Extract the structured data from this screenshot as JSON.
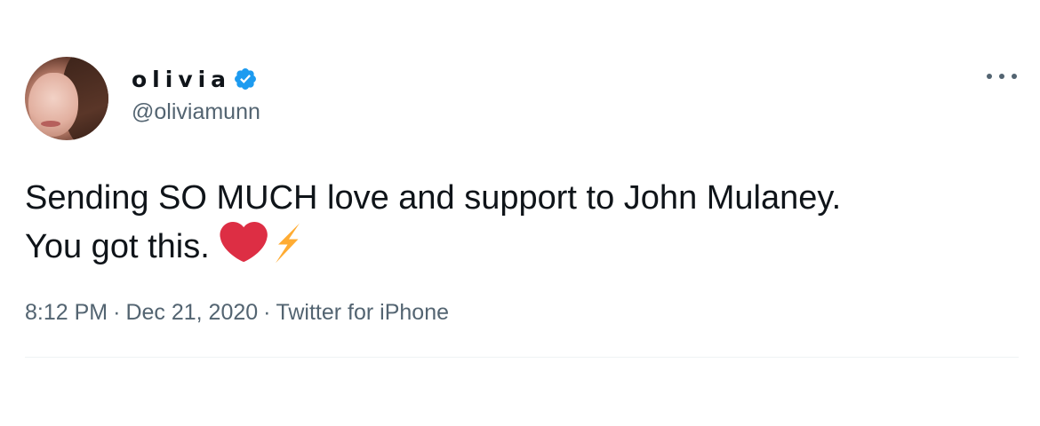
{
  "author": {
    "display_name": "olivia",
    "handle": "@oliviamunn",
    "verified": true,
    "verified_color": "#1d9bf0",
    "avatar_icon": "profile-photo"
  },
  "tweet": {
    "text_line1": "Sending SO MUCH love and support to John Mulaney.",
    "text_line2": "You got this.",
    "emojis": [
      "red-heart",
      "high-voltage"
    ]
  },
  "meta": {
    "time": "8:12 PM",
    "separator": "·",
    "date": "Dec 21, 2020",
    "source": "Twitter for iPhone"
  },
  "menu": {
    "icon": "more-options-icon"
  },
  "colors": {
    "text": "#0f1419",
    "secondary": "#536471",
    "heart": "#dd2e44",
    "bolt": "#ffac33"
  }
}
